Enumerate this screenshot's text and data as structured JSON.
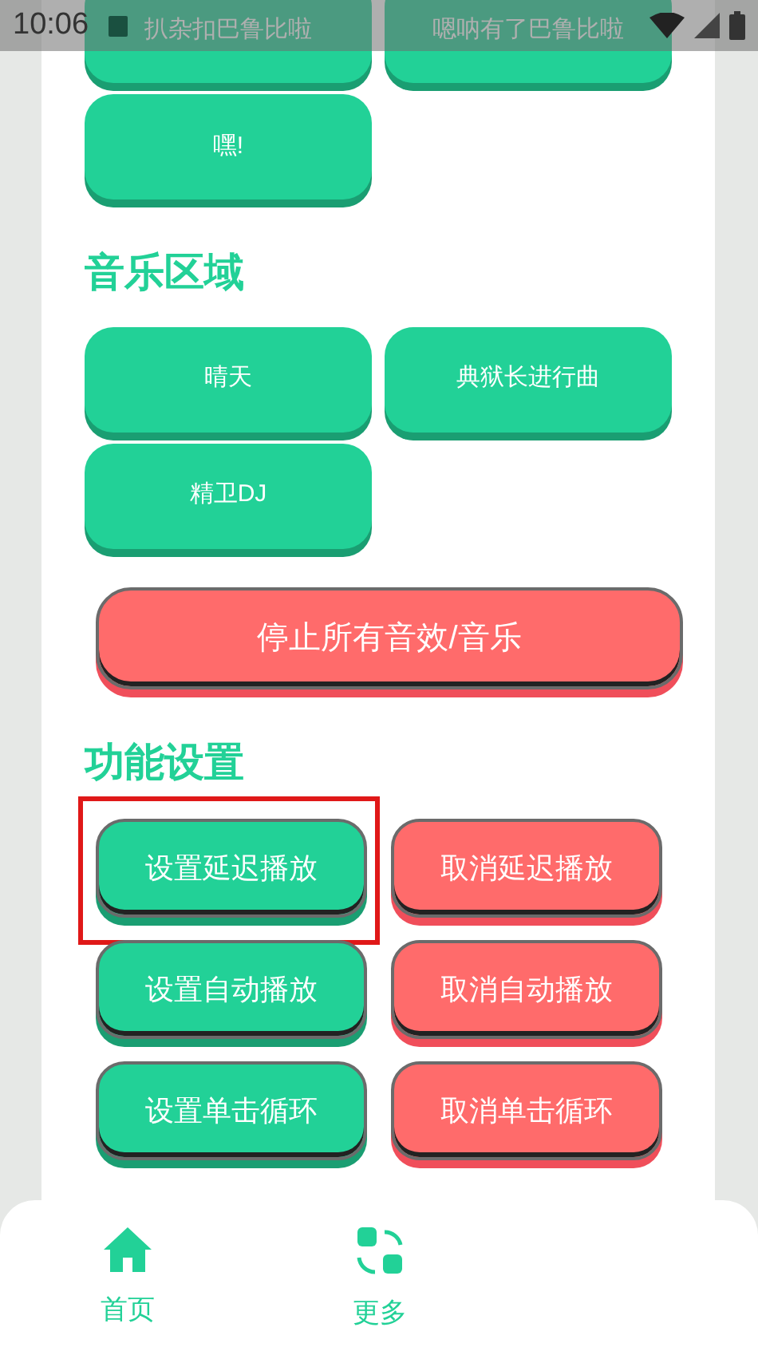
{
  "status_bar": {
    "time": "10:06"
  },
  "top_buttons": [
    {
      "label": "扒杂扣巴鲁比啦"
    },
    {
      "label": "嗯呐有了巴鲁比啦"
    },
    {
      "label": "嘿!"
    }
  ],
  "music": {
    "title": "音乐区域",
    "buttons": [
      {
        "label": "晴天"
      },
      {
        "label": "典狱长进行曲"
      },
      {
        "label": "精卫DJ"
      }
    ]
  },
  "stop_button": {
    "label": "停止所有音效/音乐"
  },
  "settings": {
    "title": "功能设置",
    "buttons": [
      {
        "label": "设置延迟播放",
        "color": "#22d197",
        "highlighted": true
      },
      {
        "label": "取消延迟播放",
        "color": "#ff6b6b",
        "highlighted": false
      },
      {
        "label": "设置自动播放",
        "color": "#22d197",
        "highlighted": false
      },
      {
        "label": "取消自动播放",
        "color": "#ff6b6b",
        "highlighted": false
      },
      {
        "label": "设置单击循环",
        "color": "#22d197",
        "highlighted": false
      },
      {
        "label": "取消单击循环",
        "color": "#ff6b6b",
        "highlighted": false
      }
    ]
  },
  "nav": [
    {
      "label": "首页",
      "kind": "home"
    },
    {
      "label": "更多",
      "kind": "more"
    }
  ]
}
